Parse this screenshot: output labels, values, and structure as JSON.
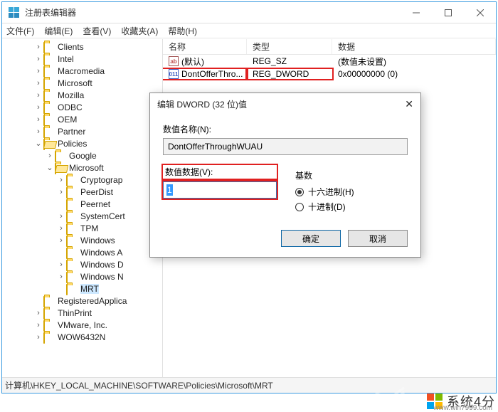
{
  "window": {
    "title": "注册表编辑器"
  },
  "menu": {
    "file": "文件(F)",
    "edit": "编辑(E)",
    "view": "查看(V)",
    "favorites": "收藏夹(A)",
    "help": "帮助(H)"
  },
  "tree": {
    "items": [
      {
        "label": "Clients",
        "depth": 3,
        "expander": ">"
      },
      {
        "label": "Intel",
        "depth": 3,
        "expander": ">"
      },
      {
        "label": "Macromedia",
        "depth": 3,
        "expander": ">"
      },
      {
        "label": "Microsoft",
        "depth": 3,
        "expander": ">"
      },
      {
        "label": "Mozilla",
        "depth": 3,
        "expander": ">"
      },
      {
        "label": "ODBC",
        "depth": 3,
        "expander": ">"
      },
      {
        "label": "OEM",
        "depth": 3,
        "expander": ">"
      },
      {
        "label": "Partner",
        "depth": 3,
        "expander": ">"
      },
      {
        "label": "Policies",
        "depth": 3,
        "expander": "v",
        "open": true
      },
      {
        "label": "Google",
        "depth": 4,
        "expander": ">"
      },
      {
        "label": "Microsoft",
        "depth": 4,
        "expander": "v",
        "open": true
      },
      {
        "label": "Cryptograp",
        "depth": 5,
        "expander": ">"
      },
      {
        "label": "PeerDist",
        "depth": 5,
        "expander": ">"
      },
      {
        "label": "Peernet",
        "depth": 5,
        "expander": ""
      },
      {
        "label": "SystemCert",
        "depth": 5,
        "expander": ">"
      },
      {
        "label": "TPM",
        "depth": 5,
        "expander": ">"
      },
      {
        "label": "Windows",
        "depth": 5,
        "expander": ">"
      },
      {
        "label": "Windows A",
        "depth": 5,
        "expander": ""
      },
      {
        "label": "Windows D",
        "depth": 5,
        "expander": ">"
      },
      {
        "label": "Windows N",
        "depth": 5,
        "expander": ">"
      },
      {
        "label": "MRT",
        "depth": 5,
        "expander": "",
        "selected": true
      },
      {
        "label": "RegisteredApplica",
        "depth": 3,
        "expander": ""
      },
      {
        "label": "ThinPrint",
        "depth": 3,
        "expander": ">"
      },
      {
        "label": "VMware, Inc.",
        "depth": 3,
        "expander": ">"
      },
      {
        "label": "WOW6432N",
        "depth": 3,
        "expander": ">",
        "cut": true
      }
    ]
  },
  "list": {
    "headers": {
      "name": "名称",
      "type": "类型",
      "data": "数据"
    },
    "rows": [
      {
        "name": "(默认)",
        "type": "REG_SZ",
        "data": "(数值未设置)",
        "kind": "sz"
      },
      {
        "name": "DontOfferThro...",
        "type": "REG_DWORD",
        "data": "0x00000000 (0)",
        "kind": "bin",
        "highlighted": true
      }
    ]
  },
  "statusbar": {
    "path": "计算机\\HKEY_LOCAL_MACHINE\\SOFTWARE\\Policies\\Microsoft\\MRT"
  },
  "dialog": {
    "title": "编辑 DWORD (32 位)值",
    "name_label": "数值名称(N):",
    "name_value": "DontOfferThroughWUAU",
    "data_label": "数值数据(V):",
    "data_value": "1",
    "base_label": "基数",
    "radio_hex": "十六进制(H)",
    "radio_dec": "十进制(D)",
    "ok": "确定",
    "cancel": "取消"
  },
  "watermark": {
    "text": "系统4分",
    "url": "www.win7999.com"
  }
}
